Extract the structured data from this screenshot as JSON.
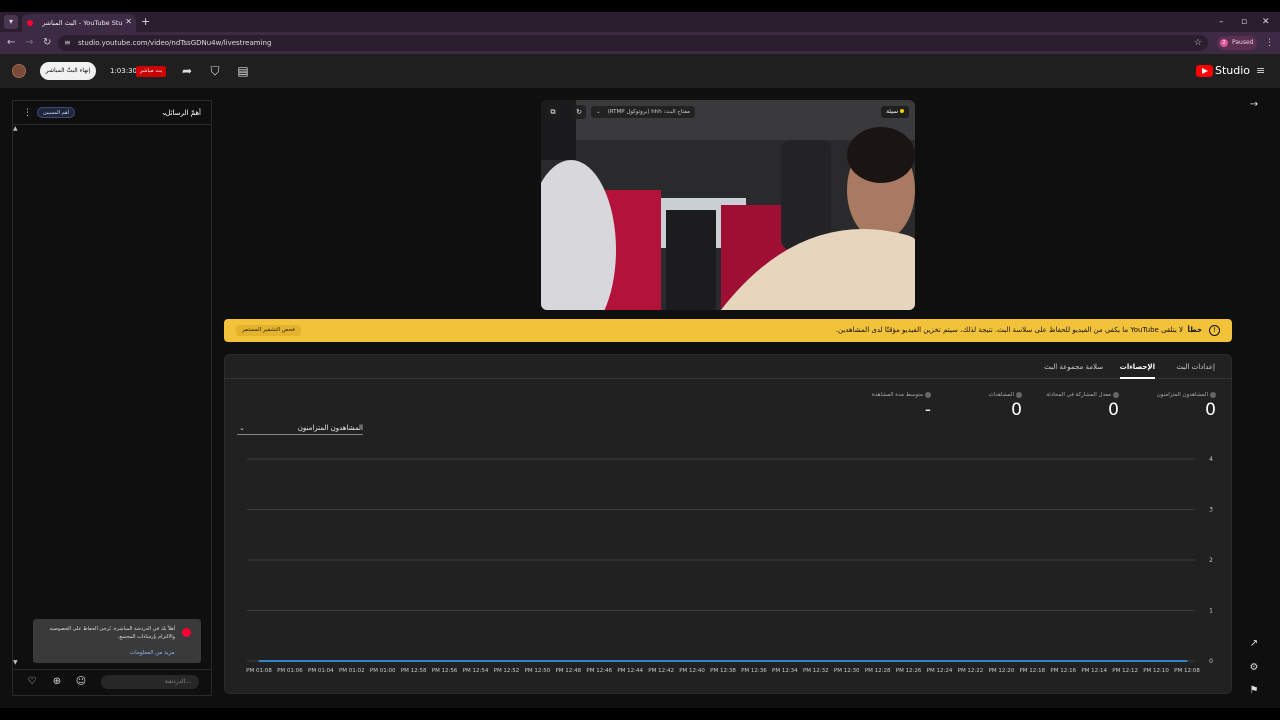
{
  "browser": {
    "tab_title": "البث المباشر - YouTube Studio",
    "url": "studio.youtube.com/video/ndTssGDNu4w/livestreaming",
    "profile_initial": "2",
    "profile_status": "Paused"
  },
  "header": {
    "end_stream_label": "إنهاء البثّ المباشر",
    "timer": "1:03:30",
    "live_badge": "بث مباشر",
    "logo_text": "Studio"
  },
  "chat": {
    "title": "أهمّ الرسائل",
    "top_pill": "أهم المسيين",
    "notice_text": "أهلاً بك في الدردشة المباشرة. يُرجى الحفاظ على الخصوصية والالتزام بإرشادات المجتمع.",
    "notice_link": "مزيد من المعلومات",
    "input_placeholder": "الدردشة..."
  },
  "video": {
    "status_badge": "سيئة",
    "stream_key_label": "مفتاح البث: hhh (بروتوكول RTMP)"
  },
  "banner": {
    "error_word": "خطأ",
    "message": "لا يتلقى YouTube ما يكفي من الفيديو للحفاظ على سلاسة البث. نتيجة لذلك، سيتم تخزين الفيديو مؤقتًا لدى المشاهدين.",
    "check_button": "فحص التشفير المستمر"
  },
  "tabs": [
    {
      "label": "إعدادات البث",
      "active": false
    },
    {
      "label": "الإحصاءات",
      "active": true
    },
    {
      "label": "سلامة مجموعة البث",
      "active": false
    }
  ],
  "metrics": [
    {
      "label": "المشاهدون المتزامنون",
      "value": "0"
    },
    {
      "label": "معدل المشاركة في المحادثة",
      "value": "0"
    },
    {
      "label": "المشاهدات",
      "value": "0"
    },
    {
      "label": "متوسط مدة المشاهدة",
      "value": "-"
    }
  ],
  "chart_selector": "المشاهدون المتزامنون",
  "chart_data": {
    "type": "line",
    "title": "",
    "xlabel": "",
    "ylabel": "",
    "ylim": [
      0,
      4
    ],
    "yticks": [
      0,
      1,
      2,
      3,
      4
    ],
    "x": [
      "12:08 PM",
      "12:10 PM",
      "12:12 PM",
      "12:14 PM",
      "12:16 PM",
      "12:18 PM",
      "12:20 PM",
      "12:22 PM",
      "12:24 PM",
      "12:26 PM",
      "12:28 PM",
      "12:30 PM",
      "12:32 PM",
      "12:34 PM",
      "12:36 PM",
      "12:38 PM",
      "12:40 PM",
      "12:42 PM",
      "12:44 PM",
      "12:46 PM",
      "12:48 PM",
      "12:50 PM",
      "12:52 PM",
      "12:54 PM",
      "12:56 PM",
      "12:58 PM",
      "01:00 PM",
      "01:02 PM",
      "01:04 PM",
      "01:06 PM",
      "01:08 PM"
    ],
    "x_labels_display": [
      "PM 12:08",
      "PM 12:10",
      "PM 12:12",
      "PM 12:14",
      "PM 12:16",
      "PM 12:18",
      "PM 12:20",
      "PM 12:22",
      "PM 12:24",
      "PM 12:26",
      "PM 12:28",
      "PM 12:30",
      "PM 12:32",
      "PM 12:34",
      "PM 12:36",
      "PM 12:38",
      "PM 12:40",
      "PM 12:42",
      "PM 12:44",
      "PM 12:46",
      "PM 12:48",
      "PM 12:50",
      "PM 12:52",
      "PM 12:54",
      "PM 12:56",
      "PM 12:58",
      "PM 01:00",
      "PM 01:02",
      "PM 01:04",
      "PM 01:06",
      "PM 01:08"
    ],
    "series": [
      {
        "values": [
          0,
          0,
          0,
          0,
          0,
          0,
          0,
          0,
          0,
          0,
          0,
          0,
          0,
          0,
          0,
          0,
          0,
          0,
          0,
          0,
          0,
          0,
          0,
          0,
          0,
          0,
          0,
          0,
          0,
          0,
          0
        ]
      }
    ],
    "grid": true,
    "line_color": "#3ea6ff"
  }
}
